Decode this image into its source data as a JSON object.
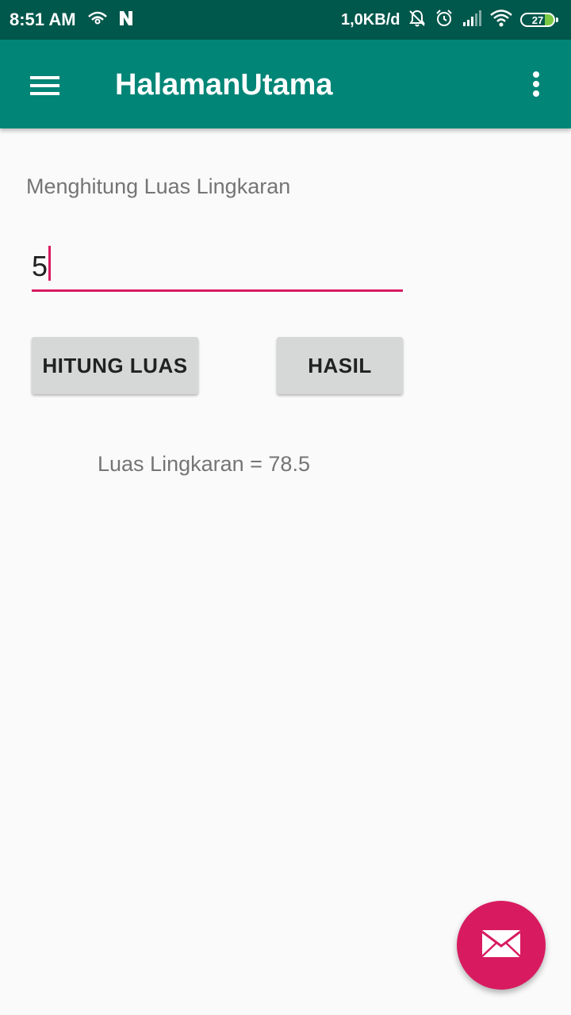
{
  "status_bar": {
    "time": "8:51 AM",
    "network_speed": "1,0KB/d",
    "battery_level": "27",
    "left_icons": [
      "wifi-eye-icon",
      "n-notification-icon"
    ],
    "right_icons": [
      "silent-bell-icon",
      "alarm-icon",
      "signal-icon",
      "wifi-icon",
      "battery-icon"
    ]
  },
  "app_bar": {
    "title": "HalamanUtama",
    "menu_icon": "hamburger-menu-icon",
    "overflow_icon": "more-vert-icon"
  },
  "content": {
    "heading": "Menghitung Luas Lingkaran",
    "input_value": "5",
    "hitung_button_label": "HITUNG LUAS",
    "hasil_button_label": "HASIL",
    "result_text": "Luas Lingkaran = 78.5"
  },
  "fab": {
    "icon": "email-icon"
  },
  "colors": {
    "status_bar": "#00574b",
    "app_bar": "#008577",
    "accent": "#d81b60",
    "button": "#d6d7d7",
    "background": "#fafafa"
  }
}
